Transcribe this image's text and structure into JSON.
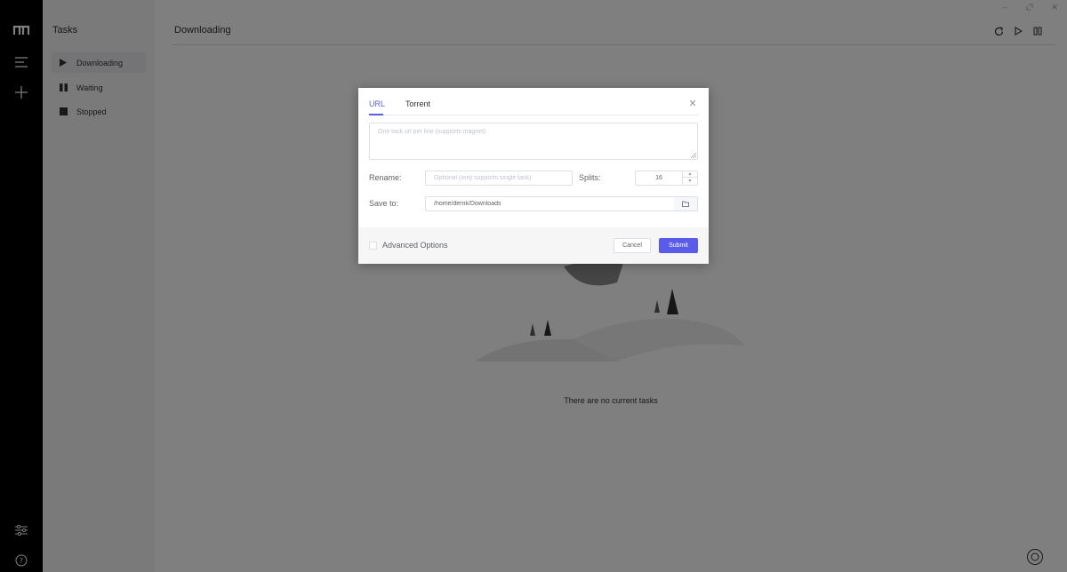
{
  "sidebar": {
    "title": "Tasks",
    "items": [
      {
        "label": "Downloading",
        "icon": "play-icon",
        "active": true
      },
      {
        "label": "Waiting",
        "icon": "pause-icon",
        "active": false
      },
      {
        "label": "Stopped",
        "icon": "stop-icon",
        "active": false
      }
    ]
  },
  "main": {
    "title": "Downloading",
    "empty_text": "There are no current tasks"
  },
  "dialog": {
    "tabs": [
      {
        "label": "URL",
        "active": true
      },
      {
        "label": "Torrent",
        "active": false
      }
    ],
    "url_placeholder": "One task url per line (supports magnet)",
    "rename_label": "Rename:",
    "rename_placeholder": "Optional (only supports single task)",
    "splits_label": "Splits:",
    "splits_value": "16",
    "save_to_label": "Save to:",
    "save_to_value": "/home/derrik/Downloads",
    "advanced_label": "Advanced Options",
    "cancel_label": "Cancel",
    "submit_label": "Submit"
  },
  "colors": {
    "accent": "#5b5bea",
    "rail": "#000000",
    "sidebar_bg": "#f4f5f7"
  }
}
